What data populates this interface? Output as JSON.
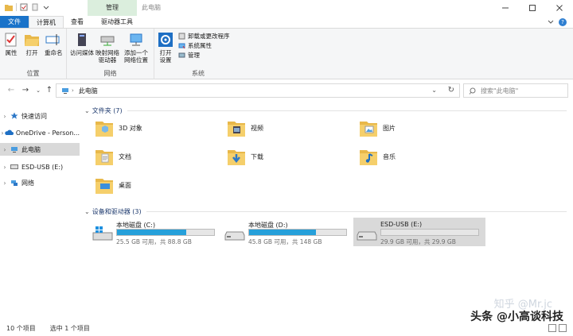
{
  "window": {
    "title": "此电脑",
    "context_tab": "管理"
  },
  "tabs": {
    "file": "文件",
    "computer": "计算机",
    "view": "查看",
    "drive_tools": "驱动器工具"
  },
  "ribbon": {
    "location_group": {
      "label": "位置",
      "properties": "属性",
      "open": "打开",
      "rename": "重命名"
    },
    "network_group": {
      "label": "网络",
      "access_media_1": "访问媒体",
      "access_media_2": "",
      "map_drive_1": "映射网络",
      "map_drive_2": "驱动器",
      "add_location_1": "添加一个",
      "add_location_2": "网络位置"
    },
    "system_group": {
      "label": "系统",
      "open_settings_1": "打开",
      "open_settings_2": "设置",
      "uninstall": "卸载或更改程序",
      "system_properties": "系统属性",
      "manage": "管理"
    }
  },
  "address": {
    "path": "此电脑",
    "search_placeholder": "搜索\"此电脑\""
  },
  "sidebar": {
    "items": [
      {
        "label": "快速访问"
      },
      {
        "label": "OneDrive - Person..."
      },
      {
        "label": "此电脑"
      },
      {
        "label": "ESD-USB (E:)"
      },
      {
        "label": "网络"
      }
    ]
  },
  "folders_section": {
    "title": "文件夹 (7)",
    "items": [
      {
        "label": "3D 对象"
      },
      {
        "label": "视频"
      },
      {
        "label": "图片"
      },
      {
        "label": "文档"
      },
      {
        "label": "下载"
      },
      {
        "label": "音乐"
      },
      {
        "label": "桌面"
      }
    ]
  },
  "devices_section": {
    "title": "设备和驱动器 (3)",
    "drives": [
      {
        "name": "本地磁盘 (C:)",
        "free": "25.5 GB 可用，共 88.8 GB",
        "used_fraction": 0.71
      },
      {
        "name": "本地磁盘 (D:)",
        "free": "45.8 GB 可用，共 148 GB",
        "used_fraction": 0.69
      },
      {
        "name": "ESD-USB (E:)",
        "free": "29.9 GB 可用，共 29.9 GB",
        "used_fraction": 0.0
      }
    ]
  },
  "status": {
    "count": "10 个项目",
    "selected": "选中 1 个项目"
  },
  "watermark": {
    "text": "头条 @小高谈科技",
    "sub": "知乎 @Mr.jc"
  },
  "colors": {
    "file_tab": "#1a73c9",
    "context_tab": "#dbeedd",
    "drive_fill": "#26a0da",
    "selected": "#d9d9d9"
  }
}
